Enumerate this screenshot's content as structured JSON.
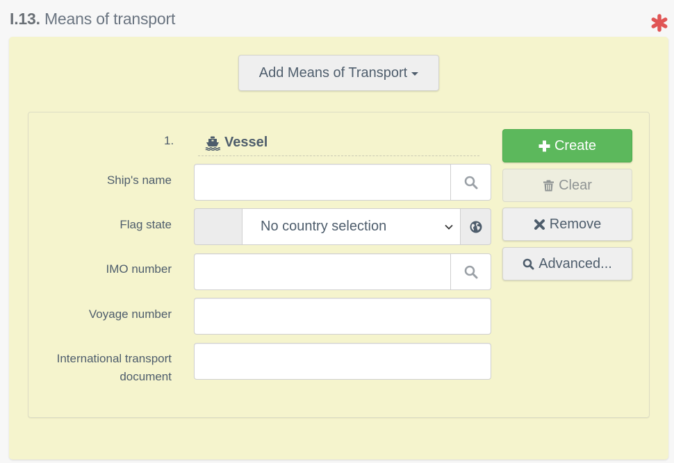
{
  "section": {
    "number": "I.13.",
    "title": "Means of transport",
    "required_icon": "asterisk-icon",
    "required_color": "#e05555"
  },
  "add_button": {
    "label": "Add Means of Transport",
    "icon": "caret-down-icon"
  },
  "transport_item": {
    "index": "1.",
    "type_icon": "ship-icon",
    "type_label": "Vessel",
    "fields": [
      {
        "label": "Ship's name",
        "value": "",
        "addon_icon": "search-icon"
      },
      {
        "label": "Flag state",
        "selected": "No country selection",
        "addon_icon": "globe-icon"
      },
      {
        "label": "IMO number",
        "value": "",
        "addon_icon": "search-icon"
      },
      {
        "label": "Voyage number",
        "value": ""
      },
      {
        "label": "International transport document",
        "value": ""
      }
    ]
  },
  "actions": {
    "create": {
      "label": "Create",
      "icon": "plus-icon",
      "color": "#5cb85c"
    },
    "clear": {
      "label": "Clear",
      "icon": "trash-icon"
    },
    "remove": {
      "label": "Remove",
      "icon": "times-icon"
    },
    "advanced": {
      "label": "Advanced...",
      "icon": "search-icon"
    }
  }
}
